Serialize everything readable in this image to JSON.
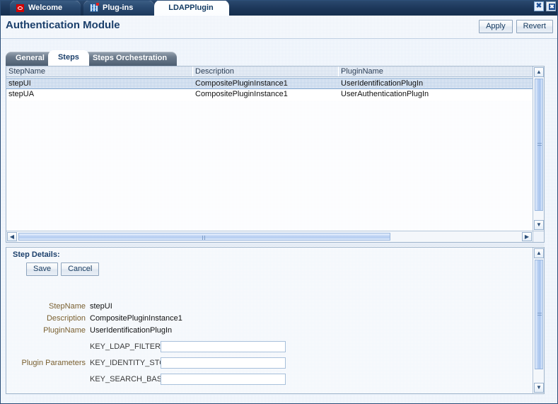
{
  "window": {
    "doc_tabs": [
      {
        "label": "Welcome",
        "icon": "oracle-logo-icon",
        "active": false
      },
      {
        "label": "Plug-ins",
        "icon": "grid-icon",
        "active": false
      },
      {
        "label": "LDAPPlugin",
        "icon": "none",
        "active": true
      }
    ],
    "controls": [
      {
        "name": "close-icon",
        "glyph": "✖"
      },
      {
        "name": "detach-window-icon",
        "glyph": "✖"
      }
    ]
  },
  "header": {
    "title": "Authentication Module",
    "apply_label": "Apply",
    "revert_label": "Revert"
  },
  "inner_tabs": [
    {
      "label": "General",
      "active": false
    },
    {
      "label": "Steps",
      "active": true
    },
    {
      "label": "Steps Orchestration",
      "active": false
    }
  ],
  "steps_table": {
    "columns": [
      "StepName",
      "Description",
      "PluginName"
    ],
    "rows": [
      {
        "StepName": "stepUI",
        "Description": "CompositePluginInstance1",
        "PluginName": "UserIdentificationPlugIn",
        "selected": true
      },
      {
        "StepName": "stepUA",
        "Description": "CompositePluginInstance1",
        "PluginName": "UserAuthenticationPlugIn",
        "selected": false
      }
    ],
    "scroll_up_glyph": "▲",
    "scroll_down_glyph": "▼",
    "scroll_left_glyph": "◀",
    "scroll_right_glyph": "▶"
  },
  "step_details": {
    "title": "Step Details:",
    "save_label": "Save",
    "cancel_label": "Cancel",
    "fields": [
      {
        "label": "StepName",
        "value": "stepUI"
      },
      {
        "label": "Description",
        "value": "CompositePluginInstance1"
      },
      {
        "label": "PluginName",
        "value": "UserIdentificationPlugIn"
      }
    ],
    "params_label": "Plugin Parameters",
    "params": [
      {
        "key": "KEY_LDAP_FILTER",
        "value": "",
        "placeholder": ""
      },
      {
        "key": "KEY_IDENTITY_STORE_REF",
        "value": "",
        "placeholder": ""
      },
      {
        "key": "KEY_SEARCH_BASE_URL",
        "value": "",
        "placeholder": ""
      }
    ],
    "scroll_up_glyph": "▲",
    "scroll_down_glyph": "▼"
  },
  "colors": {
    "tabbar_bg": "#1e3a5f",
    "title_text": "#1b3f6b",
    "row_selected": "#c2d4ea",
    "label_text": "#7a6030",
    "accent": "#2d4f78"
  }
}
